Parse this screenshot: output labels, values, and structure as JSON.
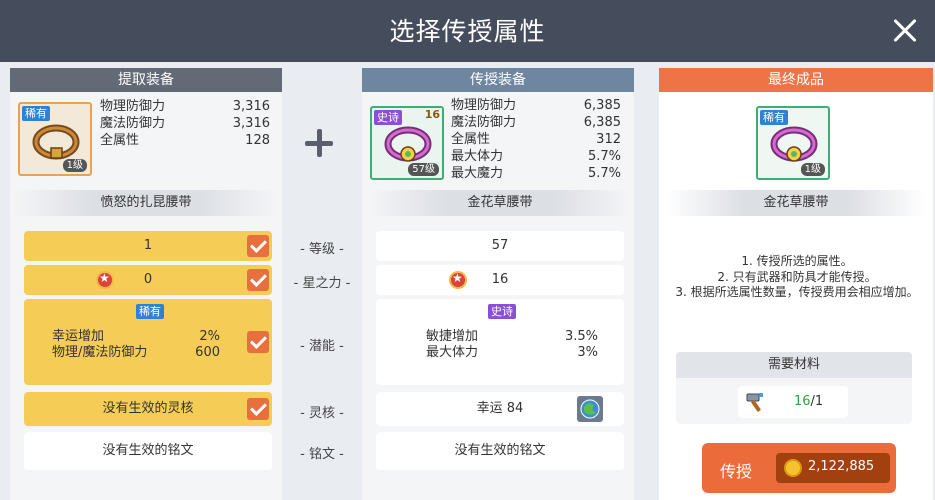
{
  "title": "选择传授属性",
  "left": {
    "header": "提取装备",
    "rank": "稀有",
    "level": "1级",
    "stats": [
      {
        "label": "物理防御力",
        "value": "3,316"
      },
      {
        "label": "魔法防御力",
        "value": "3,316"
      },
      {
        "label": "全属性",
        "value": "128"
      }
    ],
    "name": "愤怒的扎昆腰带",
    "level_row": "1",
    "star_force": "0",
    "potential_rank": "稀有",
    "potential_lines": [
      {
        "label": "幸运增加",
        "value": "2%"
      },
      {
        "label": "物理/魔法防御力",
        "value": "600"
      }
    ],
    "core": "没有生效的灵核",
    "inscription": "没有生效的铭文"
  },
  "middle_labels": {
    "level": "- 等级 -",
    "star": "- 星之力 -",
    "potential": "- 潜能 -",
    "core": "- 灵核 -",
    "inscription": "- 铭文 -"
  },
  "mid": {
    "header": "传授装备",
    "rank": "史诗",
    "stars": "16",
    "level": "57级",
    "stats": [
      {
        "label": "物理防御力",
        "value": "6,385"
      },
      {
        "label": "魔法防御力",
        "value": "6,385"
      },
      {
        "label": "全属性",
        "value": "312"
      },
      {
        "label": "最大体力",
        "value": "5.7%"
      },
      {
        "label": "最大魔力",
        "value": "5.7%"
      }
    ],
    "name": "金花草腰带",
    "level_row": "57",
    "star_force": "16",
    "potential_rank": "史诗",
    "potential_lines": [
      {
        "label": "敏捷增加",
        "value": "3.5%"
      },
      {
        "label": "最大体力",
        "value": "3%"
      }
    ],
    "core": "幸运 84",
    "inscription": "没有生效的铭文"
  },
  "right": {
    "header": "最终成品",
    "rank": "稀有",
    "level": "1级",
    "name": "金花草腰带",
    "notes": [
      "1. 传授所选的属性。",
      "2. 只有武器和防具才能传授。",
      "3. 根据所选属性数量，传授费用会相应增加。"
    ],
    "materials_header": "需要材料",
    "material_have": "16",
    "material_need": "/1",
    "button_label": "传授",
    "cost": "2,122,885"
  },
  "colors": {
    "accent": "#ec6b3a",
    "rare": "#2d82d6",
    "epic": "#8b4fd6",
    "checked": "#f5cc55"
  }
}
